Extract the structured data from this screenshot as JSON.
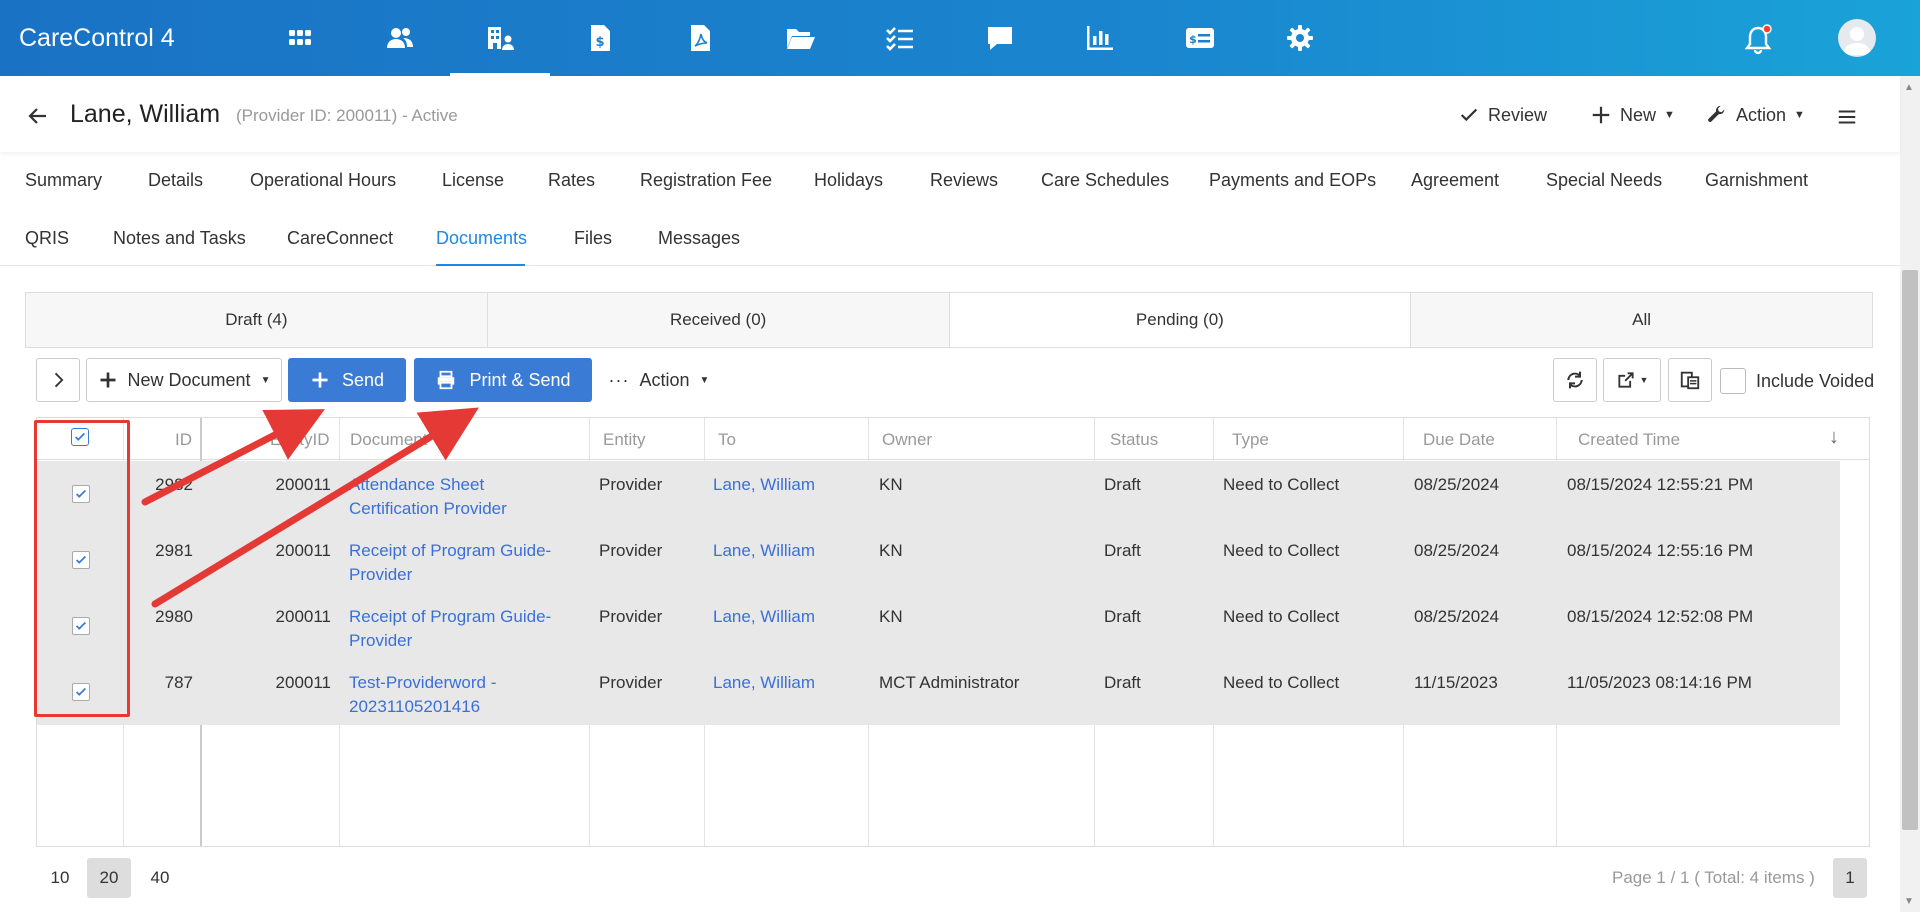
{
  "app": {
    "title": "CareControl 4"
  },
  "topnav": {
    "icons": [
      "apps-grid-icon",
      "users-icon",
      "provider-building-icon",
      "invoice-dollar-icon",
      "pdf-file-icon",
      "folder-open-icon",
      "checklist-icon",
      "chat-icon",
      "bar-chart-icon",
      "id-card-icon",
      "gear-icon"
    ],
    "active_index": 2
  },
  "header": {
    "name": "Lane, William",
    "subtitle": "(Provider ID: 200011) - Active",
    "review": "Review",
    "new": "New",
    "action": "Action"
  },
  "tabs_row1": [
    "Summary",
    "Details",
    "Operational Hours",
    "License",
    "Rates",
    "Registration Fee",
    "Holidays",
    "Reviews",
    "Care Schedules",
    "Payments and EOPs",
    "Agreement",
    "Special Needs",
    "Garnishment"
  ],
  "tabs_row2": [
    "QRIS",
    "Notes and Tasks",
    "CareConnect",
    "Documents",
    "Files",
    "Messages"
  ],
  "active_tab": "Documents",
  "segments": [
    "Draft (4)",
    "Received (0)",
    "Pending (0)",
    "All"
  ],
  "toolbar": {
    "new_document": "New Document",
    "send": "Send",
    "print_send": "Print & Send",
    "action": "Action",
    "include_voided": "Include Voided"
  },
  "grid": {
    "columns": [
      "ID",
      "EntityID",
      "Document",
      "Entity",
      "To",
      "Owner",
      "Status",
      "Type",
      "Due Date",
      "Created Time"
    ],
    "rows": [
      {
        "id": "2982",
        "entity_id": "200011",
        "document_l1": "Attendance Sheet",
        "document_l2": "Certification Provider",
        "entity": "Provider",
        "to": "Lane, William",
        "owner": "KN",
        "status": "Draft",
        "type": "Need to Collect",
        "due": "08/25/2024",
        "created": "08/15/2024 12:55:21 PM"
      },
      {
        "id": "2981",
        "entity_id": "200011",
        "document_l1": "Receipt of Program Guide-",
        "document_l2": "Provider",
        "entity": "Provider",
        "to": "Lane, William",
        "owner": "KN",
        "status": "Draft",
        "type": "Need to Collect",
        "due": "08/25/2024",
        "created": "08/15/2024 12:55:16 PM"
      },
      {
        "id": "2980",
        "entity_id": "200011",
        "document_l1": "Receipt of Program Guide-",
        "document_l2": "Provider",
        "entity": "Provider",
        "to": "Lane, William",
        "owner": "KN",
        "status": "Draft",
        "type": "Need to Collect",
        "due": "08/25/2024",
        "created": "08/15/2024 12:52:08 PM"
      },
      {
        "id": "787",
        "entity_id": "200011",
        "document_l1": "Test-Providerword -",
        "document_l2": "20231105201416",
        "entity": "Provider",
        "to": "Lane, William",
        "owner": "MCT Administrator",
        "status": "Draft",
        "type": "Need to Collect",
        "due": "11/15/2023",
        "created": "11/05/2023 08:14:16 PM"
      }
    ]
  },
  "pager": {
    "sizes": [
      "10",
      "20",
      "40"
    ],
    "selected_size": "20",
    "info": "Page 1 / 1 ( Total: 4 items )",
    "page": "1"
  },
  "colors": {
    "topbar": "#1a86cf",
    "accent": "#1e88e5",
    "button": "#3a7bd5",
    "annotation": "#e53935"
  }
}
